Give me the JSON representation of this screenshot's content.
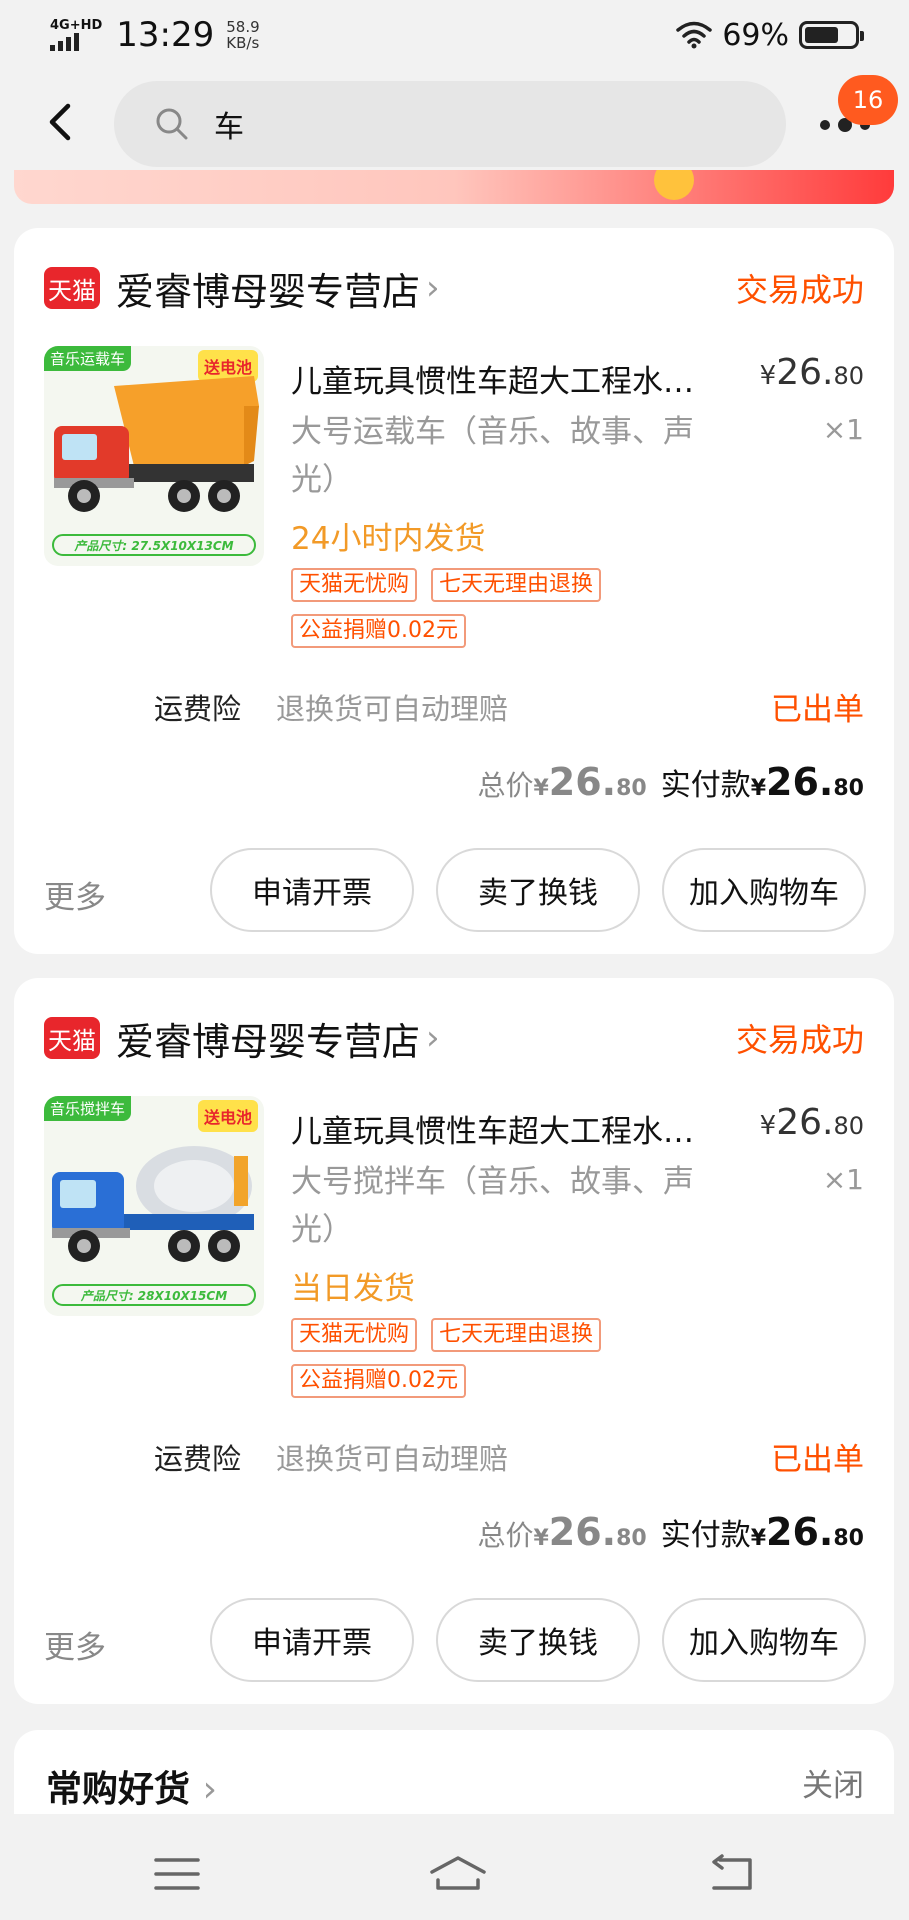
{
  "status_bar": {
    "network": "4G+HD",
    "time": "13:29",
    "speed_value": "58.9",
    "speed_unit": "KB/s",
    "battery": "69%",
    "battery_level": 0.69
  },
  "header": {
    "search_value": "车",
    "badge_count": "16"
  },
  "orders": [
    {
      "store_logo": "天猫",
      "store_name": "爱睿博母婴专营店",
      "status": "交易成功",
      "thumb_tag": "音乐运载车",
      "thumb_promo": "送电池",
      "thumb_size": "产品尺寸: 27.5X10X13CM",
      "title": "儿童玩具惯性车超大工程水…",
      "price_symbol": "¥",
      "price_int": "26.",
      "price_dec": "80",
      "sku": "大号运载车（音乐、故事、声光）",
      "qty": "×1",
      "shipping": "24小时内发货",
      "badges": [
        "天猫无忧购",
        "七天无理由退换",
        "公益捐赠0.02元"
      ],
      "insurance_label": "运费险",
      "insurance_desc": "退换货可自动理赔",
      "insurance_status": "已出单",
      "total_label": "总价",
      "total_symbol": "¥",
      "total_int": "26.",
      "total_dec": "80",
      "paid_label": "实付款",
      "paid_symbol": "¥",
      "paid_int": "26.",
      "paid_dec": "80",
      "more_label": "更多",
      "buttons": [
        "申请开票",
        "卖了换钱",
        "加入购物车"
      ]
    },
    {
      "store_logo": "天猫",
      "store_name": "爱睿博母婴专营店",
      "status": "交易成功",
      "thumb_tag": "音乐搅拌车",
      "thumb_promo": "送电池",
      "thumb_size": "产品尺寸: 28X10X15CM",
      "title": "儿童玩具惯性车超大工程水…",
      "price_symbol": "¥",
      "price_int": "26.",
      "price_dec": "80",
      "sku": "大号搅拌车（音乐、故事、声光）",
      "qty": "×1",
      "shipping": "当日发货",
      "badges": [
        "天猫无忧购",
        "七天无理由退换",
        "公益捐赠0.02元"
      ],
      "insurance_label": "运费险",
      "insurance_desc": "退换货可自动理赔",
      "insurance_status": "已出单",
      "total_label": "总价",
      "total_symbol": "¥",
      "total_int": "26.",
      "total_dec": "80",
      "paid_label": "实付款",
      "paid_symbol": "¥",
      "paid_int": "26.",
      "paid_dec": "80",
      "more_label": "更多",
      "buttons": [
        "申请开票",
        "卖了换钱",
        "加入购物车"
      ]
    }
  ],
  "recommend": {
    "title": "常购好货",
    "chevron": "›",
    "close_label": "关闭"
  },
  "colors": {
    "accent": "#ff5000",
    "shipping": "#f29a27",
    "tmall_red": "#e8262c"
  },
  "icons": {
    "back": "chevron-left-icon",
    "search": "search-icon",
    "more": "more-dots-icon",
    "nav_menu": "menu-icon",
    "nav_home": "home-icon",
    "nav_back": "back-icon"
  }
}
